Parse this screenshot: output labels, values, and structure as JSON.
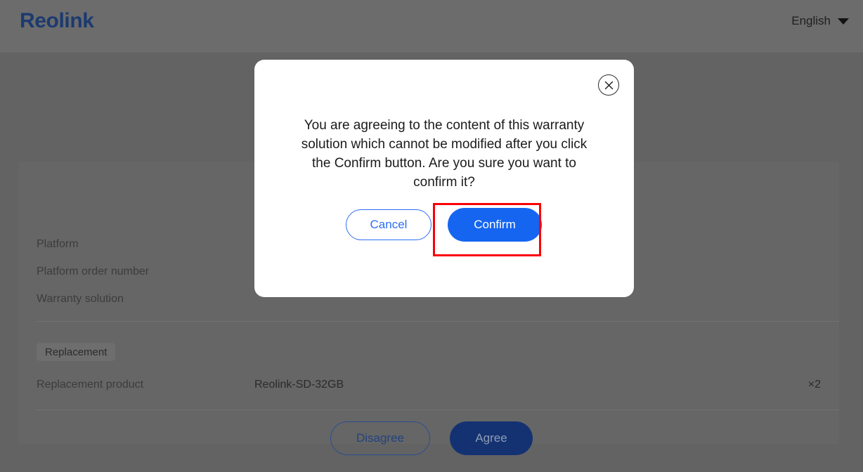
{
  "header": {
    "brand": "Reolink",
    "language": "English",
    "caret_icon": "chevron-down-icon"
  },
  "card": {
    "rows": [
      {
        "label": "Platform",
        "value": "",
        "qty": ""
      },
      {
        "label": "Platform order number",
        "value": "",
        "qty": ""
      },
      {
        "label": "Warranty solution",
        "value": "",
        "qty": ""
      }
    ],
    "tag": "Replacement",
    "product_row": {
      "label": "Replacement product",
      "value": "Reolink-SD-32GB",
      "qty": "×2"
    }
  },
  "page_actions": {
    "disagree": "Disagree",
    "agree": "Agree"
  },
  "modal": {
    "close_icon": "close-icon",
    "message": "You are agreeing to the content of this warranty solution which cannot be modified after you click the Confirm button. Are you sure you want to confirm it?",
    "cancel": "Cancel",
    "confirm": "Confirm"
  },
  "colors": {
    "brand": "#1c3a70",
    "primary": "#1565f0",
    "cancel_border": "#2f6ef0",
    "agree_bg": "#143272",
    "highlight": "#fb0007",
    "overlay": "#666666"
  }
}
